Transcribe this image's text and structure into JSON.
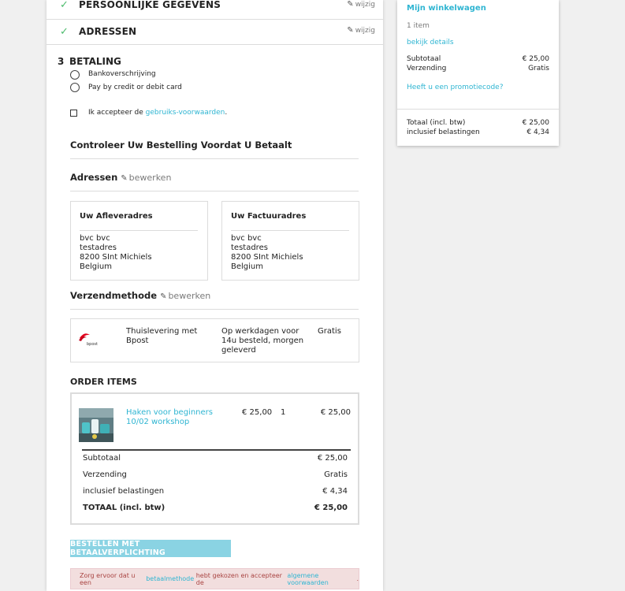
{
  "steps": {
    "personal": {
      "title": "Persoonlijke gegevens",
      "edit": "wijzig"
    },
    "addresses": {
      "title": "Adressen",
      "edit": "wijzig"
    },
    "payment": {
      "number": "3",
      "title": "Betaling"
    }
  },
  "payment_options": [
    {
      "label": "Bankoverschrijving"
    },
    {
      "label": "Pay by credit or debit card"
    }
  ],
  "terms": {
    "prefix": "Ik accepteer de ",
    "link": "gebruiks-voorwaarden",
    "suffix": "."
  },
  "review": {
    "heading": "Controleer Uw Bestelling Voordat U Betaalt",
    "addresses_heading": "Adressen",
    "edit_label": "bewerken",
    "delivery": {
      "title": "Uw Afleveradres",
      "lines": [
        "bvc bvc",
        "testadres",
        "8200 SInt Michiels",
        "Belgium"
      ]
    },
    "invoice": {
      "title": "Uw Factuuradres",
      "lines": [
        "bvc bvc",
        "testadres",
        "8200 SInt Michiels",
        "Belgium"
      ]
    },
    "shipping_heading": "Verzendmethode",
    "shipping": {
      "logo_text": "bpost",
      "name": "Thuislevering met Bpost",
      "delay": "Op werkdagen voor 14u besteld, morgen geleverd",
      "price": "Gratis"
    }
  },
  "order": {
    "heading": "ORDER ITEMS",
    "items": [
      {
        "name": "Haken voor beginners 10/02 workshop",
        "price": "€ 25,00",
        "qty": "1",
        "total": "€ 25,00"
      }
    ],
    "totals": [
      {
        "label": "Subtotaal",
        "value": "€ 25,00"
      },
      {
        "label": "Verzending",
        "value": "Gratis"
      },
      {
        "label": "inclusief belastingen",
        "value": "€ 4,34"
      },
      {
        "label": "TOTAAL (incl. btw)",
        "value": "€ 25,00"
      }
    ]
  },
  "submit_button": "Bestellen met betaalverplichting",
  "alert": {
    "part1": "Zorg ervoor dat u een ",
    "link1": "betaalmethode",
    "part2": " hebt gekozen en accepteer de ",
    "link2": "algemene voorwaarden",
    "part3": "."
  },
  "cart": {
    "title": "Mijn winkelwagen",
    "count": "1 item",
    "details": "bekijk details",
    "subtotal_label": "Subtotaal",
    "subtotal": "€ 25,00",
    "shipping_label": "Verzending",
    "shipping": "Gratis",
    "promo": "Heeft u een promotiecode?",
    "total_label": "Totaal (incl. btw)",
    "total": "€ 25,00",
    "tax_label": "inclusief belastingen",
    "tax": "€ 4,34"
  },
  "colors": {
    "accent": "#2fb5d2",
    "check": "#4cbb6c",
    "button": "#8ad3e3",
    "alert_bg": "#f2dede",
    "alert_text": "#a94442"
  }
}
